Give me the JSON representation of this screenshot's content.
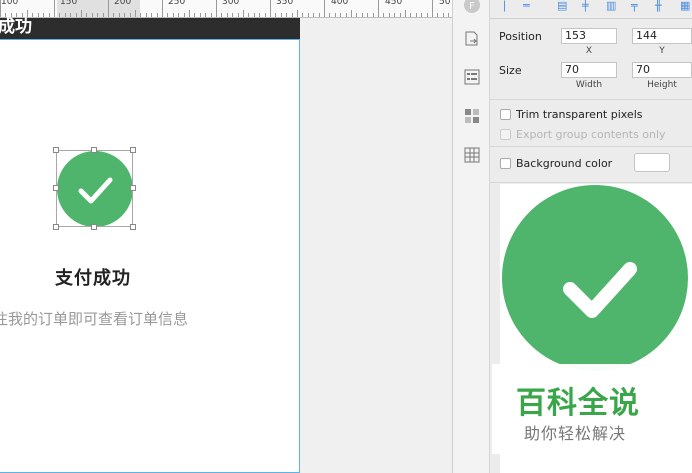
{
  "ruler": {
    "labels": [
      "100",
      "150",
      "200",
      "250",
      "300",
      "350",
      "400",
      "450",
      "50"
    ]
  },
  "artboard": {
    "title": "成功",
    "success_text": "支付成功",
    "hint_text": "往我的订单即可查看订单信息",
    "check_color": "#4fb56c"
  },
  "toolbar": {
    "icons": [
      "export-icon",
      "style-icon",
      "layers-icon",
      "grid-icon"
    ]
  },
  "inspector": {
    "position_label": "Position",
    "position_x": "153",
    "position_y": "144",
    "x_label": "X",
    "y_label": "Y",
    "size_label": "Size",
    "width": "70",
    "height": "70",
    "width_label": "Width",
    "height_label": "Height",
    "trim_label": "Trim transparent pixels",
    "export_group_label": "Export group contents only",
    "background_color_label": "Background color"
  },
  "watermark": {
    "title": "百科全说",
    "subtitle": "助你轻松解决"
  }
}
